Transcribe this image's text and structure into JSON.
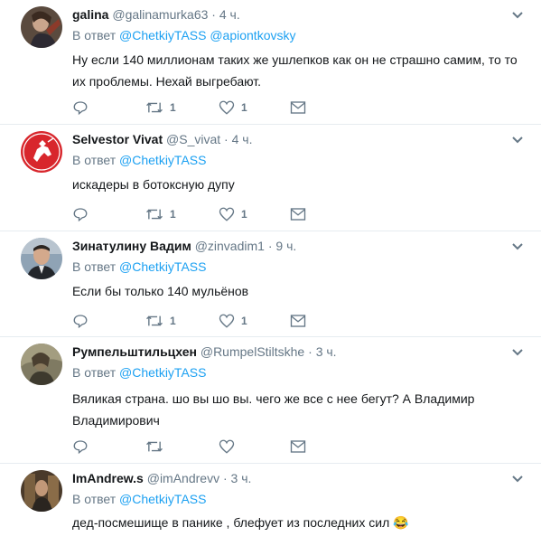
{
  "reply_prefix": "В ответ",
  "tweets": [
    {
      "fullname": "galina",
      "username": "@galinamurka63",
      "dot": "·",
      "time": "4 ч.",
      "mentions": [
        "@ChetkiyTASS",
        "@apiontkovsky"
      ],
      "lines": [
        "Ну если 140 миллионам таких же ушлепков как он не страшно самим, то то",
        "их проблемы. Нехай выгребают."
      ],
      "retweets": "1",
      "likes": "1"
    },
    {
      "fullname": "Selvestor Vivat",
      "username": "@S_vivat",
      "dot": "·",
      "time": "4 ч.",
      "mentions": [
        "@ChetkiyTASS"
      ],
      "lines": [
        "искадеры в ботоксную дупу"
      ],
      "retweets": "1",
      "likes": "1"
    },
    {
      "fullname": "Зинатулину Вадим",
      "username": "@zinvadim1",
      "dot": "·",
      "time": "9 ч.",
      "mentions": [
        "@ChetkiyTASS"
      ],
      "lines": [
        "Если бы только 140 мульёнов"
      ],
      "retweets": "1",
      "likes": "1"
    },
    {
      "fullname": "Румпельштильцхен",
      "username": "@RumpelStiltskhe",
      "dot": "·",
      "time": "3 ч.",
      "mentions": [
        "@ChetkiyTASS"
      ],
      "lines": [
        "Вяликая страна. шо вы шо вы. чего же все с нее бегут? А Владимир",
        "Владимирович"
      ],
      "retweets": "",
      "likes": ""
    },
    {
      "fullname": "ImAndrew.s",
      "username": "@imAndrevv",
      "dot": "·",
      "time": "3 ч.",
      "mentions": [
        "@ChetkiyTASS"
      ],
      "lines": [
        "дед-посмешище в панике , блефует из последних сил 😂"
      ],
      "retweets": "",
      "likes": ""
    }
  ],
  "colors": {
    "accent": "#1da1f2",
    "muted": "#657786",
    "text": "#14171a",
    "divider": "#e6ecf0"
  },
  "icons": [
    "caret-down-icon",
    "reply-icon",
    "retweet-icon",
    "like-icon",
    "dm-icon"
  ]
}
